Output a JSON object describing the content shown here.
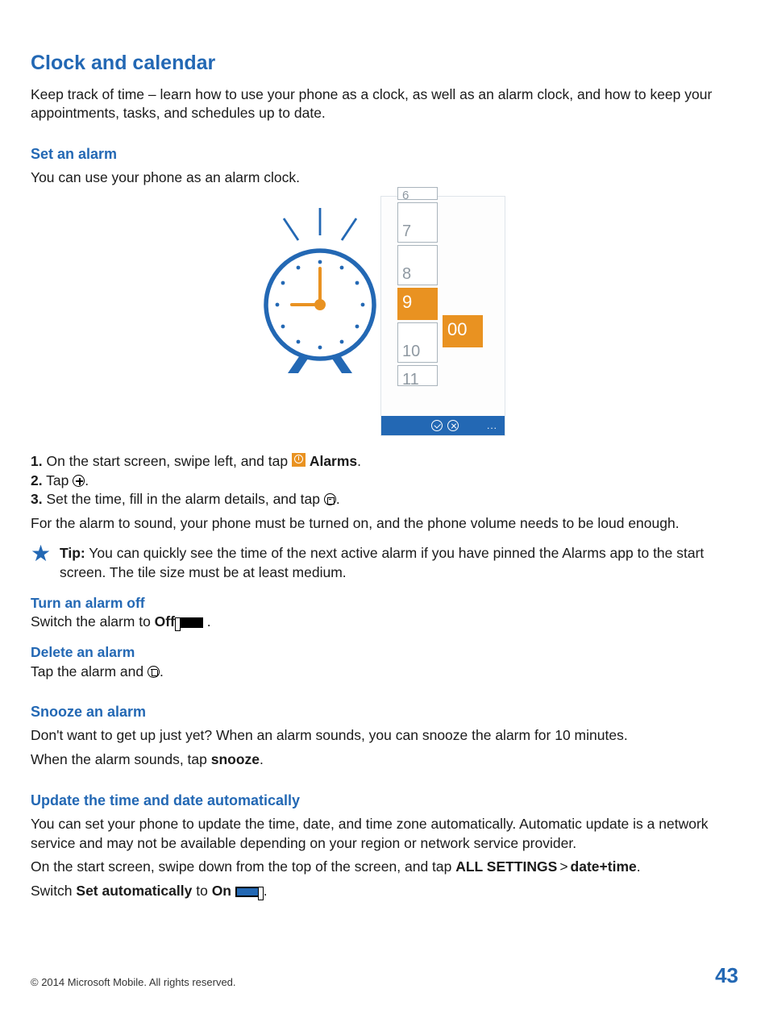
{
  "title": "Clock and calendar",
  "intro": "Keep track of time – learn how to use your phone as a clock, as well as an alarm clock, and how to keep your appointments, tasks, and schedules up to date.",
  "set_alarm": {
    "heading": "Set an alarm",
    "desc": "You can use your phone as an alarm clock.",
    "step1_prefix": "On the start screen, swipe left, and tap ",
    "step1_app": "Alarms",
    "step2_prefix": "Tap ",
    "step3_prefix": "Set the time, fill in the alarm details, and tap ",
    "note": "For the alarm to sound, your phone must be turned on, and the phone volume needs to be loud enough.",
    "tip_label": "Tip:",
    "tip_text": " You can quickly see the time of the next active alarm if you have pinned the Alarms app to the start screen. The tile size must be at least medium."
  },
  "turn_off": {
    "heading": "Turn an alarm off",
    "text_a": "Switch the alarm to ",
    "off": "Off"
  },
  "delete": {
    "heading": "Delete an alarm",
    "text_a": "Tap the alarm and "
  },
  "snooze": {
    "heading": "Snooze an alarm",
    "p1": "Don't want to get up just yet? When an alarm sounds, you can snooze the alarm for 10 minutes.",
    "p2_a": "When the alarm sounds, tap ",
    "p2_b": "snooze"
  },
  "update": {
    "heading": "Update the time and date automatically",
    "p1": "You can set your phone to update the time, date, and time zone automatically. Automatic update is a network service and may not be available depending on your region or network service provider.",
    "p2_a": "On the start screen, swipe down from the top of the screen, and tap ",
    "all_settings": "ALL SETTINGS",
    "gt": ">",
    "datetime": "date+time",
    "p3_a": "Switch ",
    "set_auto": "Set automatically",
    "p3_b": " to ",
    "on": "On"
  },
  "illus": {
    "picker_hours": [
      "6",
      "7",
      "8",
      "9",
      "10",
      "11"
    ],
    "selected_hour": "9",
    "selected_min": "00",
    "appbar_more": "..."
  },
  "steps": {
    "n1": "1.",
    "n2": "2.",
    "n3": "3."
  },
  "punct": {
    "period": ".",
    "space": " "
  },
  "footer": {
    "copyright": "© 2014 Microsoft Mobile. All rights reserved.",
    "page": "43"
  }
}
